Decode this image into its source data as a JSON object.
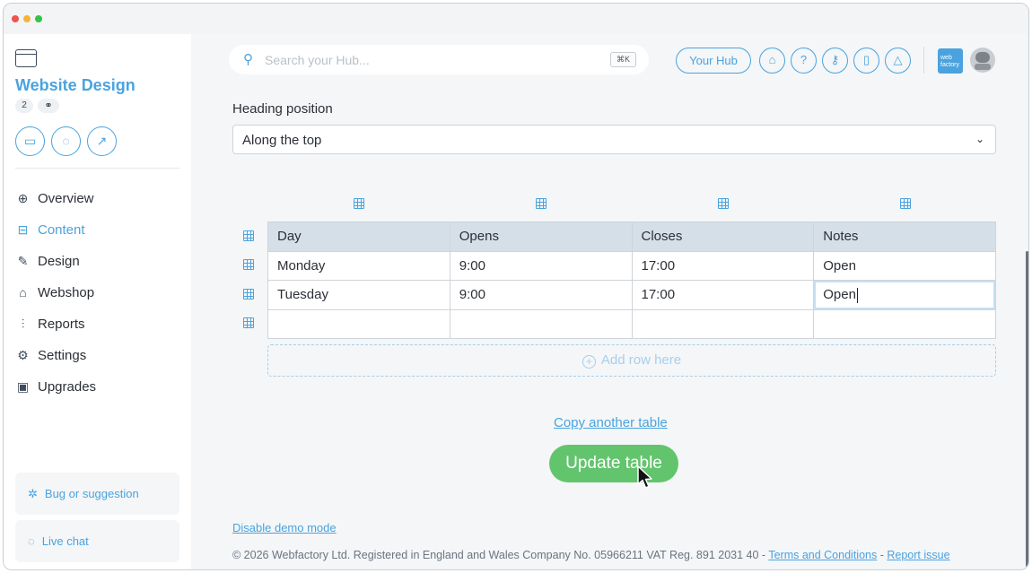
{
  "sidebar": {
    "site_title": "Website Design",
    "badge_count": "2",
    "nav": [
      {
        "label": "Overview",
        "icon": "globe-icon"
      },
      {
        "label": "Content",
        "icon": "content-icon"
      },
      {
        "label": "Design",
        "icon": "design-icon"
      },
      {
        "label": "Webshop",
        "icon": "basket-icon"
      },
      {
        "label": "Reports",
        "icon": "reports-icon"
      },
      {
        "label": "Settings",
        "icon": "gear-icon"
      },
      {
        "label": "Upgrades",
        "icon": "upgrades-icon"
      }
    ],
    "active_item": "Content",
    "bug_label": "Bug or suggestion",
    "chat_label": "Live chat"
  },
  "topbar": {
    "search_placeholder": "Search your Hub...",
    "search_shortcut": "⌘K",
    "hub_button": "Your Hub",
    "logo_text": "web factory"
  },
  "form": {
    "heading_label": "Heading position",
    "heading_value": "Along the top"
  },
  "table": {
    "headers": [
      "Day",
      "Opens",
      "Closes",
      "Notes"
    ],
    "rows": [
      [
        "Monday",
        "9:00",
        "17:00",
        "Open"
      ],
      [
        "Tuesday",
        "9:00",
        "17:00",
        "Open"
      ],
      [
        "",
        "",
        "",
        ""
      ]
    ],
    "add_row_label": "Add row here"
  },
  "actions": {
    "copy_link": "Copy another table",
    "update_button": "Update table"
  },
  "footer": {
    "demo_link": "Disable demo mode",
    "copyright": "© 2026 Webfactory Ltd. Registered in England and Wales Company No. 05966211 VAT Reg. 891 2031 40 - ",
    "terms": "Terms and Conditions",
    "separator": " - ",
    "report": "Report issue"
  },
  "colors": {
    "accent": "#4aa3de",
    "button_green": "#63c46e",
    "table_header": "#d5dfe8"
  }
}
